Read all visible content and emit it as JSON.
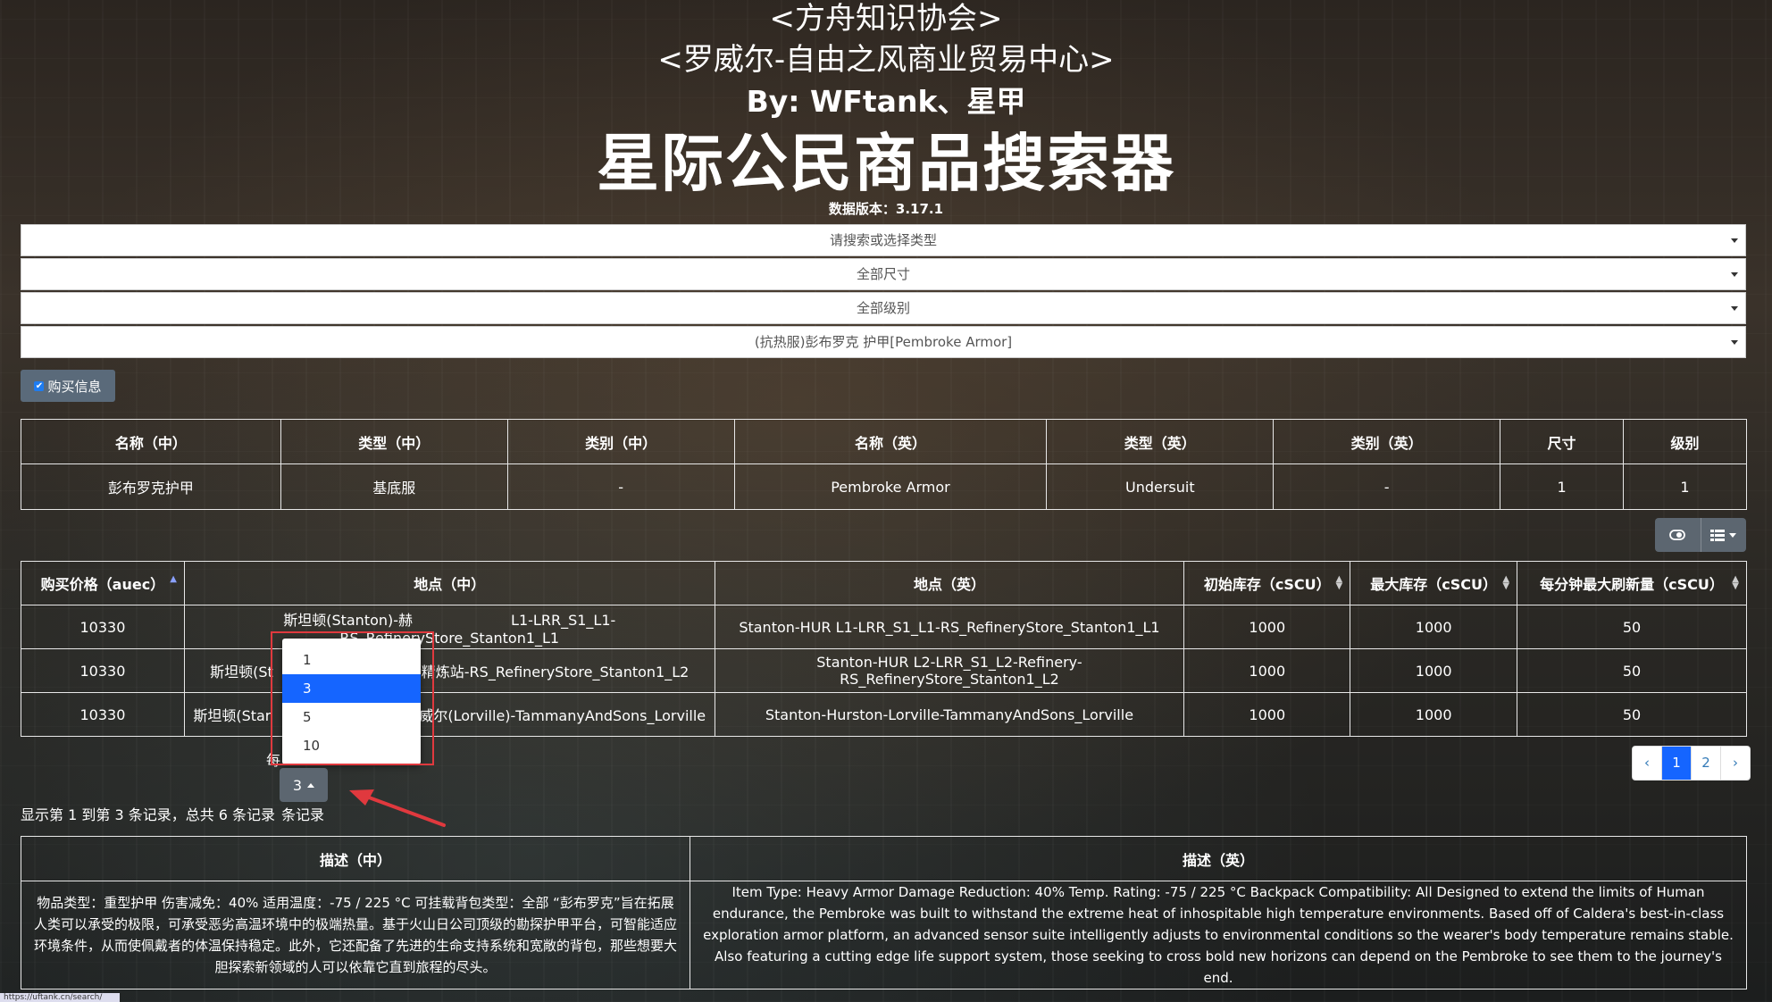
{
  "header": {
    "org": "<方舟知识协会>",
    "hub": "<罗威尔-自由之风商业贸易中心>",
    "authors": "By: WFtank、星甲",
    "title": "星际公民商品搜索器",
    "version_label": "数据版本：",
    "version": "3.17.1"
  },
  "filters": {
    "type": "请搜索或选择类型",
    "size": "全部尺寸",
    "grade": "全部级别",
    "item": "(抗热服)彭布罗克 护甲[Pembroke Armor]"
  },
  "toggle": {
    "checked": true,
    "label": "购买信息"
  },
  "item_table": {
    "headers": [
      "名称（中）",
      "类型（中）",
      "类别（中）",
      "名称（英）",
      "类型（英）",
      "类别（英）",
      "尺寸",
      "级别"
    ],
    "row": [
      "彭布罗克护甲",
      "基底服",
      "-",
      "Pembroke Armor",
      "Undersuit",
      "-",
      "1",
      "1"
    ]
  },
  "toolbar": {
    "toggle_icon": "toggle-icon",
    "columns_icon": "columns-icon"
  },
  "shop_table": {
    "headers": [
      "购买价格（auec）",
      "地点（中）",
      "地点（英）",
      "初始库存（cSCU）",
      "最大库存（cSCU）",
      "每分钟最大刷新量（cSCU）"
    ],
    "rows": [
      [
        "10330",
        "斯坦顿(Stanton)-赫",
        "L1-LRR_S1_L1-RS_RefineryStore_Stanton1_L1",
        "Stanton-HUR L1-LRR_S1_L1-RS_RefineryStore_Stanton1_L1",
        "1000",
        "1000",
        "50"
      ],
      [
        "10330",
        "斯坦顿(St",
        "2-精炼站-RS_RefineryStore_Stanton1_L2",
        "Stanton-HUR L2-LRR_S1_L2-Refinery-RS_RefineryStore_Stanton1_L2",
        "1000",
        "1000",
        "50"
      ],
      [
        "10330",
        "斯坦顿(Star",
        "罗威尔(Lorville)-TammanyAndSons_Lorville",
        "Stanton-Hurston-Lorville-TammanyAndSons_Lorville",
        "1000",
        "1000",
        "50"
      ]
    ]
  },
  "page_size": {
    "options": [
      "1",
      "3",
      "5",
      "10"
    ],
    "selected": "3",
    "prefix": "每",
    "suffix": "条记录"
  },
  "summary": "显示第 1 到第 3 条记录，总共 6 条记录",
  "pagination": {
    "prev": "‹",
    "pages": [
      "1",
      "2"
    ],
    "next": "›",
    "active": "1"
  },
  "desc_table": {
    "headers": [
      "描述（中）",
      "描述（英）"
    ],
    "cn": "物品类型：重型护甲 伤害减免：40% 适用温度：-75 / 225 °C 可挂载背包类型：全部 “彭布罗克”旨在拓展人类可以承受的极限，可承受恶劣高温环境中的极端热量。基于火山日公司顶级的勘探护甲平台，可智能适应环境条件，从而使佩戴者的体温保持稳定。此外，它还配备了先进的生命支持系统和宽敞的背包，那些想要大胆探索新领域的人可以依靠它直到旅程的尽头。",
    "en": "Item Type: Heavy Armor Damage Reduction: 40% Temp. Rating: -75 / 225 °C Backpack Compatibility: All Designed to extend the limits of Human endurance, the Pembroke was built to withstand the extreme heat of inhospitable high temperature environments. Based off of Caldera's best-in-class exploration armor platform, an advanced sensor suite intelligently adjusts to environmental conditions so the wearer's body temperature remains stable. Also featuring a cutting edge life support system, those seeking to cross bold new horizons can depend on the Pembroke to see them to the journey's end."
  },
  "status_url": "https://uftank.cn/search/"
}
